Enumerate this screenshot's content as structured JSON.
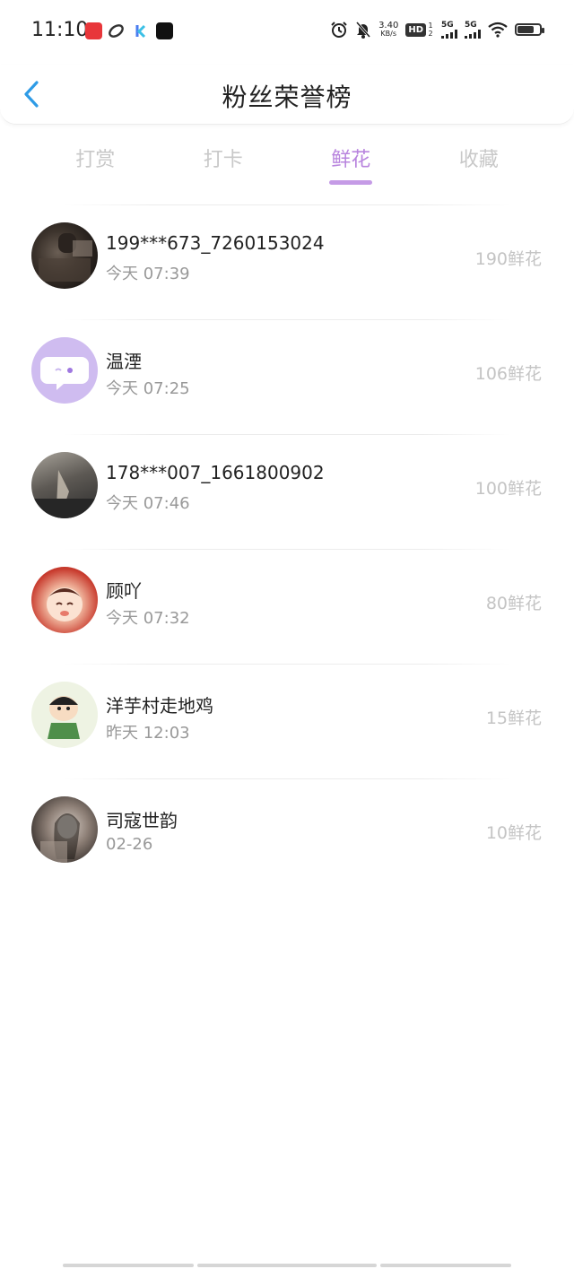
{
  "status_bar": {
    "time": "11:10",
    "net_speed_value": "3.40",
    "net_speed_unit": "KB/s",
    "hd_label": "HD",
    "hd_sub": "1 2",
    "sig1_label": "5G",
    "sig2_label": "5G"
  },
  "header": {
    "title": "粉丝荣誉榜",
    "back_icon": "chevron-left-icon"
  },
  "tabs": [
    {
      "label": "打赏",
      "active": false
    },
    {
      "label": "打卡",
      "active": false
    },
    {
      "label": "鲜花",
      "active": true
    },
    {
      "label": "收藏",
      "active": false
    }
  ],
  "list": [
    {
      "name": "199***673_7260153024",
      "time": "今天 07:39",
      "count": "190鲜花"
    },
    {
      "name": "温湮",
      "time": "今天 07:25",
      "count": "106鲜花"
    },
    {
      "name": "178***007_1661800902",
      "time": "今天 07:46",
      "count": "100鲜花"
    },
    {
      "name": "顾吖",
      "time": "今天 07:32",
      "count": "80鲜花"
    },
    {
      "name": "洋芋村走地鸡",
      "time": "昨天 12:03",
      "count": "15鲜花"
    },
    {
      "name": "司寇世韵",
      "time": "02-26",
      "count": "10鲜花"
    }
  ],
  "colors": {
    "accent": "#b884de",
    "back": "#2e9be6",
    "inactive_tab": "#c8c8c8",
    "count": "#c4c4c4"
  }
}
